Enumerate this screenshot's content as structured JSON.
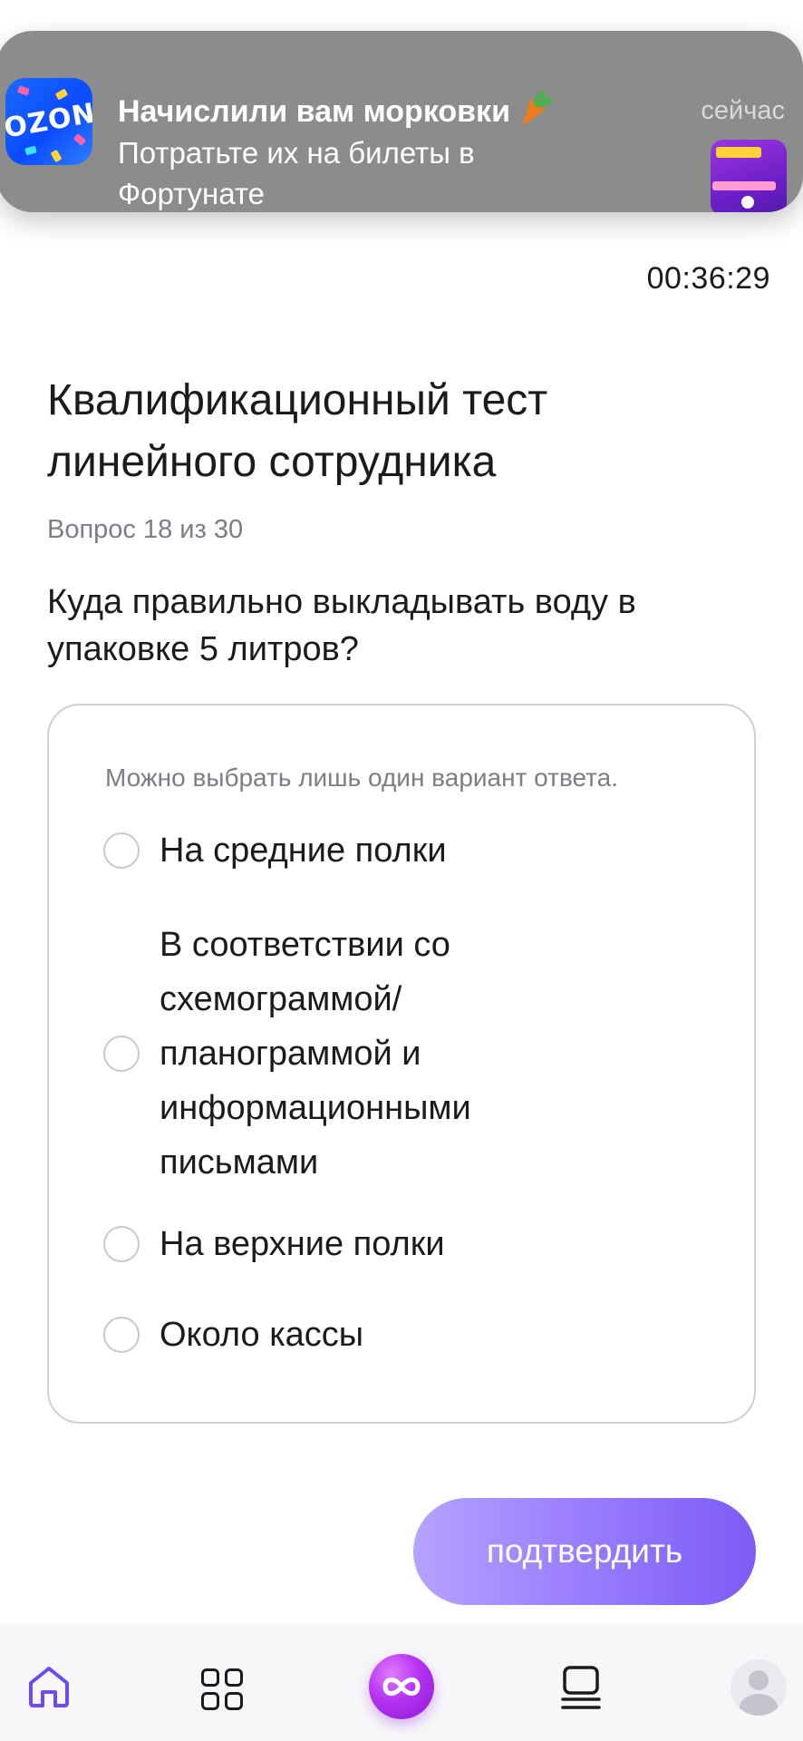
{
  "notification": {
    "app_icon": "ozon-logo-icon",
    "logo_text": "OZON",
    "title": "Начислили вам морковки",
    "title_emoji_icon": "carrot-icon",
    "body": "Потратьте их на билеты в Фортунате",
    "time": "сейчас",
    "thumbnail_icon": "fortunate-promo-thumbnail"
  },
  "timer": "00:36:29",
  "test": {
    "title": "Квалификационный тест линейного сотрудника",
    "counter": "Вопрос 18 из 30",
    "question": "Куда правильно выкладывать воду в упаковке 5 литров?"
  },
  "answers": {
    "hint": "Можно выбрать лишь один вариант ответа.",
    "options": [
      {
        "label": "На средние полки",
        "selected": false
      },
      {
        "label": "В соответствии со схемограммой/ планограммой и информационными письмами",
        "selected": false
      },
      {
        "label": "На верхние полки",
        "selected": false
      },
      {
        "label": "Около кассы",
        "selected": false
      }
    ]
  },
  "confirm_button": {
    "label": "подтвердить"
  },
  "bottom_nav": {
    "items": [
      {
        "icon": "home-icon",
        "active": true
      },
      {
        "icon": "grid-icon",
        "active": false
      },
      {
        "icon": "infinity-logo-icon",
        "active": false
      },
      {
        "icon": "catalog-icon",
        "active": false
      },
      {
        "icon": "avatar-icon",
        "active": false
      }
    ]
  },
  "colors": {
    "accent": "#7c5cf5",
    "home_active": "#6b4cf0",
    "text": "#1b1b1f",
    "muted_text": "#7d7d86",
    "notification_bg": "#8c8c8c"
  }
}
